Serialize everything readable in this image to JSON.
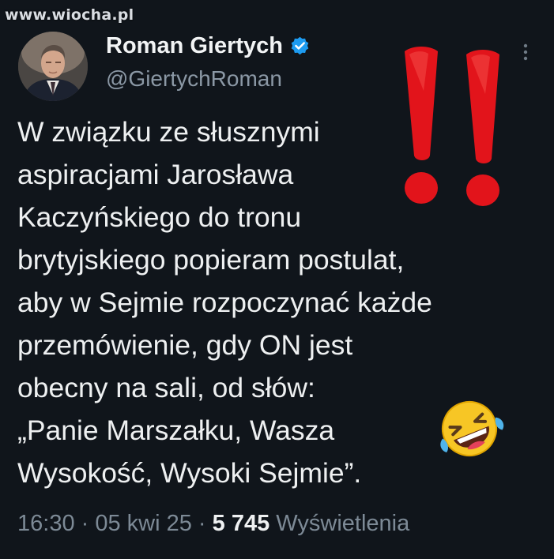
{
  "watermark": "www.wiocha.pl",
  "author": {
    "name": "Roman Giertych",
    "handle": "@GiertychRoman",
    "verified": true,
    "verified_color": "#1d9bf0"
  },
  "tweet": {
    "lines": [
      "W związku ze słusznymi",
      "aspiracjami Jarosława",
      "Kaczyńskiego do tronu",
      "brytyjskiego popieram postulat,",
      "aby w Sejmie rozpoczynać każde",
      "przemówienie, gdy ON jest",
      "obecny na sali, od słów:",
      "„Panie Marszałku, Wasza",
      "Wysokość, Wysoki Sejmie”."
    ]
  },
  "meta": {
    "time": "16:30",
    "separator_1": " · ",
    "date": "05 kwi 25",
    "separator_2": " · ",
    "views_count": "5 745",
    "views_label": " Wyświetlenia"
  },
  "icons": {
    "avatar": "avatar-photo",
    "verified": "verified-badge-icon",
    "more": "more-options-icon",
    "exclamation": "double-exclamation-icon",
    "laughing": "rolling-on-floor-laughing-icon"
  },
  "colors": {
    "background": "#10151b",
    "text": "#eef0f1",
    "muted": "#7d8a96",
    "exclamation": "#e2141b",
    "emoji": "#f7c625"
  }
}
